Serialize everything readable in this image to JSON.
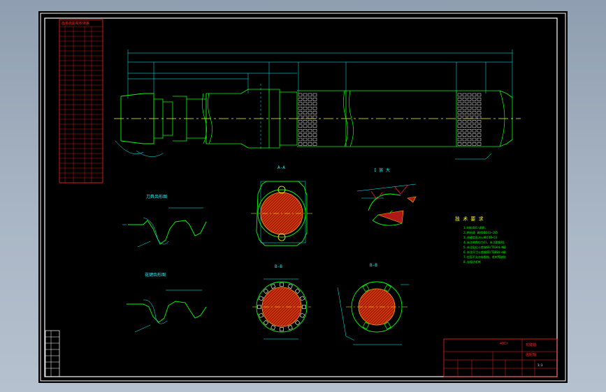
{
  "colors": {
    "background": "#000000",
    "frame": "#ffffff",
    "outline": "#00ff00",
    "dimension": "#00ffff",
    "table": "#ff2020",
    "centerline": "#ffff00",
    "section_fill": "#b01818",
    "hatch": "#ffaa00",
    "notes": "#ffff00"
  },
  "tooth_table": {
    "title": "齿条齿距累积误差",
    "rows": 32
  },
  "shaft": {
    "section_labels": [
      "A-A",
      "B-B",
      "B-B"
    ],
    "detail_label": "I 放 大",
    "detail_scale": "2:1"
  },
  "profile_views": {
    "upper_label": "刀具齿形图",
    "lower_label": "花键齿形图"
  },
  "notes": {
    "title": "技 术 要 求",
    "items": [
      "1.材料40Cr调质。",
      "2.热处理 调质HB241~285",
      "3.花键齿面淬火HRC48~53",
      "4.未注倒角均为C1，未注圆角R1",
      "5.未注形位公差按GB/T1184-K级",
      "6.未注尺寸公差按GB/T1804-m级",
      "7.齿面不允许有裂纹、毛刺等缺陷",
      "8.去锐边毛刺"
    ]
  },
  "title_block": {
    "part_name": "花键轴",
    "drawing_code": "齿轮轴",
    "material": "40Cr",
    "scale": "1:1"
  }
}
